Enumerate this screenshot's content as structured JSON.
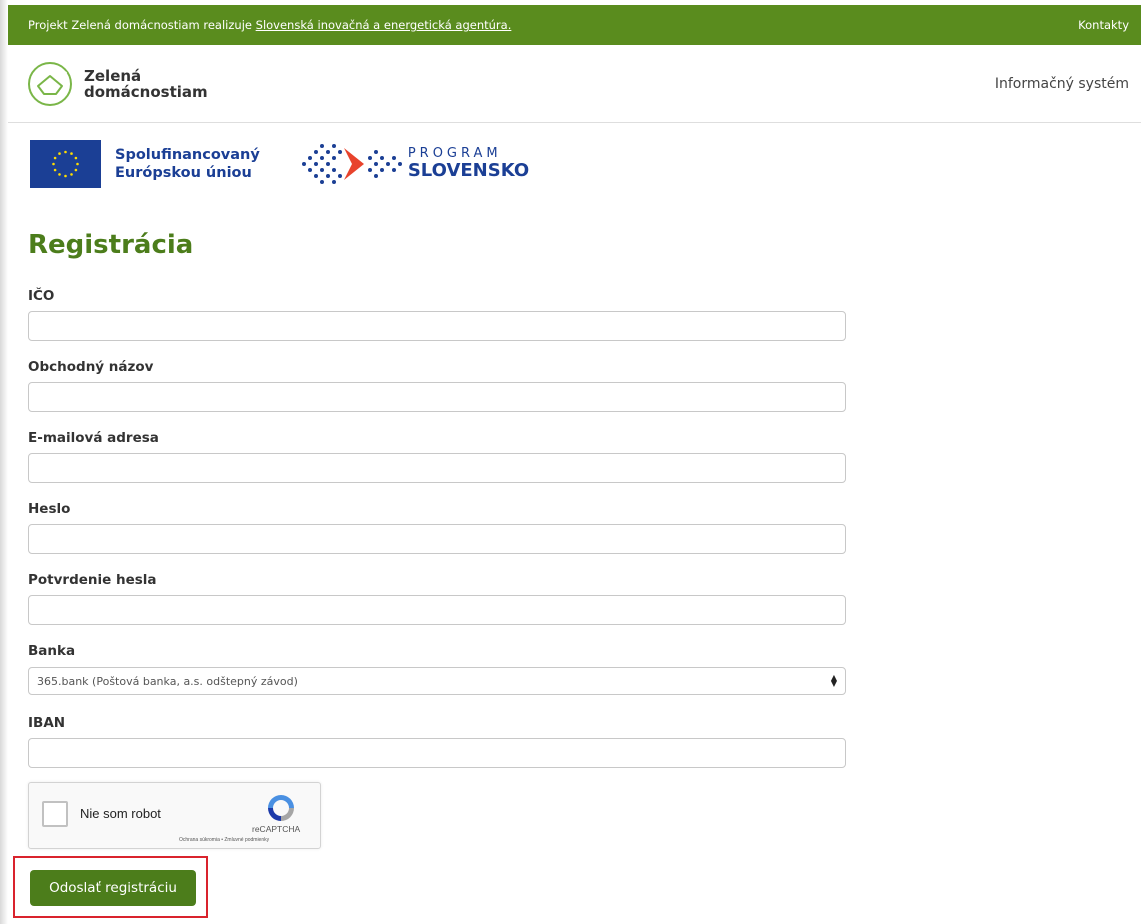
{
  "topbar": {
    "project_prefix": "Projekt Zelená domácnostiam realizuje",
    "agency_link": "Slovenská inovačná a energetická agentúra.",
    "contacts": "Kontakty"
  },
  "header": {
    "brand_line1": "Zelená",
    "brand_line2": "domácnostiam",
    "system_link": "Informačný systém"
  },
  "sponsors": {
    "eu_line1": "Spolufinancovaný",
    "eu_line2": "Európskou úniou",
    "program_top": "PROGRAM",
    "program_bottom": "SLOVENSKO"
  },
  "title": "Registrácia",
  "fields": {
    "ico": {
      "label": "IČO",
      "value": ""
    },
    "business_name": {
      "label": "Obchodný názov",
      "value": ""
    },
    "email": {
      "label": "E-mailová adresa",
      "value": ""
    },
    "password": {
      "label": "Heslo",
      "value": ""
    },
    "password_confirm": {
      "label": "Potvrdenie hesla",
      "value": ""
    },
    "bank": {
      "label": "Banka",
      "selected": "365.bank (Poštová banka, a.s. odštepný závod)"
    },
    "iban": {
      "label": "IBAN",
      "value": ""
    }
  },
  "captcha": {
    "label": "Nie som robot",
    "brand": "reCAPTCHA",
    "terms": "Ochrana súkromia • Zmluvné podmienky"
  },
  "submit": {
    "label": "Odoslať registráciu"
  },
  "colors": {
    "green_bar": "#5a8c1e",
    "title_green": "#4c7d1b",
    "eu_blue": "#1b3f95",
    "highlight_red": "#d9232d"
  }
}
